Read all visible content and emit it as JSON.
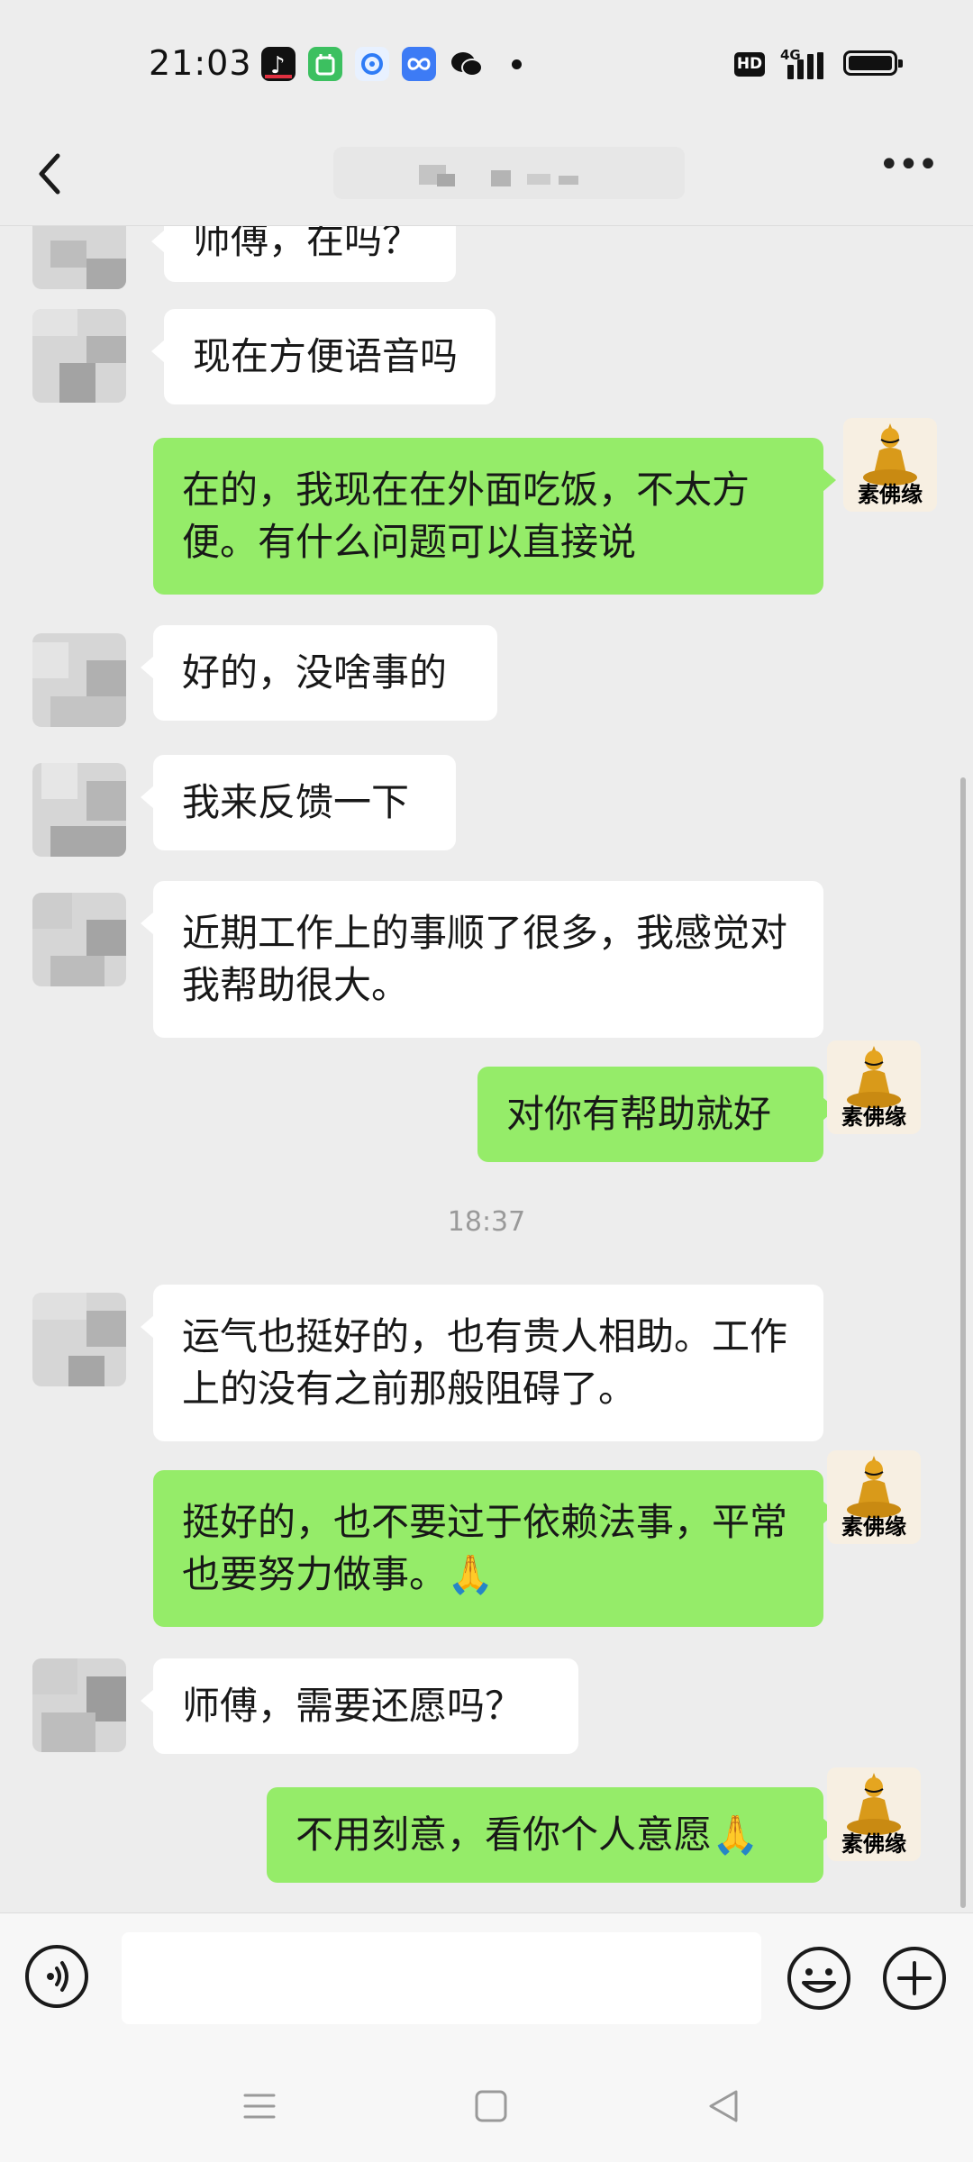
{
  "status_bar": {
    "time": "21:03",
    "hd_label": "HD",
    "network_label": "4G",
    "app_icons": [
      {
        "name": "douyin-icon",
        "color": "#111111"
      },
      {
        "name": "green-app-icon",
        "color": "#3cc060"
      },
      {
        "name": "browser-icon",
        "color": "#e8f1ff"
      },
      {
        "name": "infinity-app-icon",
        "color": "#3d7bf5"
      },
      {
        "name": "wechat-icon",
        "color": "#111111"
      }
    ]
  },
  "header": {
    "back_icon": "chevron-left-icon",
    "more_label": "•••"
  },
  "messages": [
    {
      "sender": "contact",
      "text": "师傅，在吗？"
    },
    {
      "sender": "contact",
      "text": "现在方便语音吗"
    },
    {
      "sender": "me",
      "text": "在的，我现在在外面吃饭，不太方便。有什么问题可以直接说"
    },
    {
      "sender": "contact",
      "text": "好的，没啥事的"
    },
    {
      "sender": "contact",
      "text": "我来反馈一下"
    },
    {
      "sender": "contact",
      "text": "近期工作上的事顺了很多，我感觉对我帮助很大。"
    },
    {
      "sender": "me",
      "text": "对你有帮助就好"
    },
    {
      "type": "timestamp",
      "text": "18:37"
    },
    {
      "sender": "contact",
      "text": "运气也挺好的，也有贵人相助。工作上的没有之前那般阻碍了。"
    },
    {
      "sender": "me",
      "text": "挺好的，也不要过于依赖法事，平常也要努力做事。🙏"
    },
    {
      "sender": "contact",
      "text": "师傅，需要还愿吗？"
    },
    {
      "sender": "me",
      "text": "不用刻意，看你个人意愿🙏"
    }
  ],
  "my_avatar_label": "素佛缘",
  "input_bar": {
    "placeholder": "",
    "voice_icon": "voice-icon",
    "emoji_icon": "emoji-icon",
    "plus_icon": "plus-icon"
  },
  "colors": {
    "background": "#ededed",
    "out_bubble": "#95ec69",
    "in_bubble": "#ffffff",
    "timestamp": "#9a9a9a"
  }
}
